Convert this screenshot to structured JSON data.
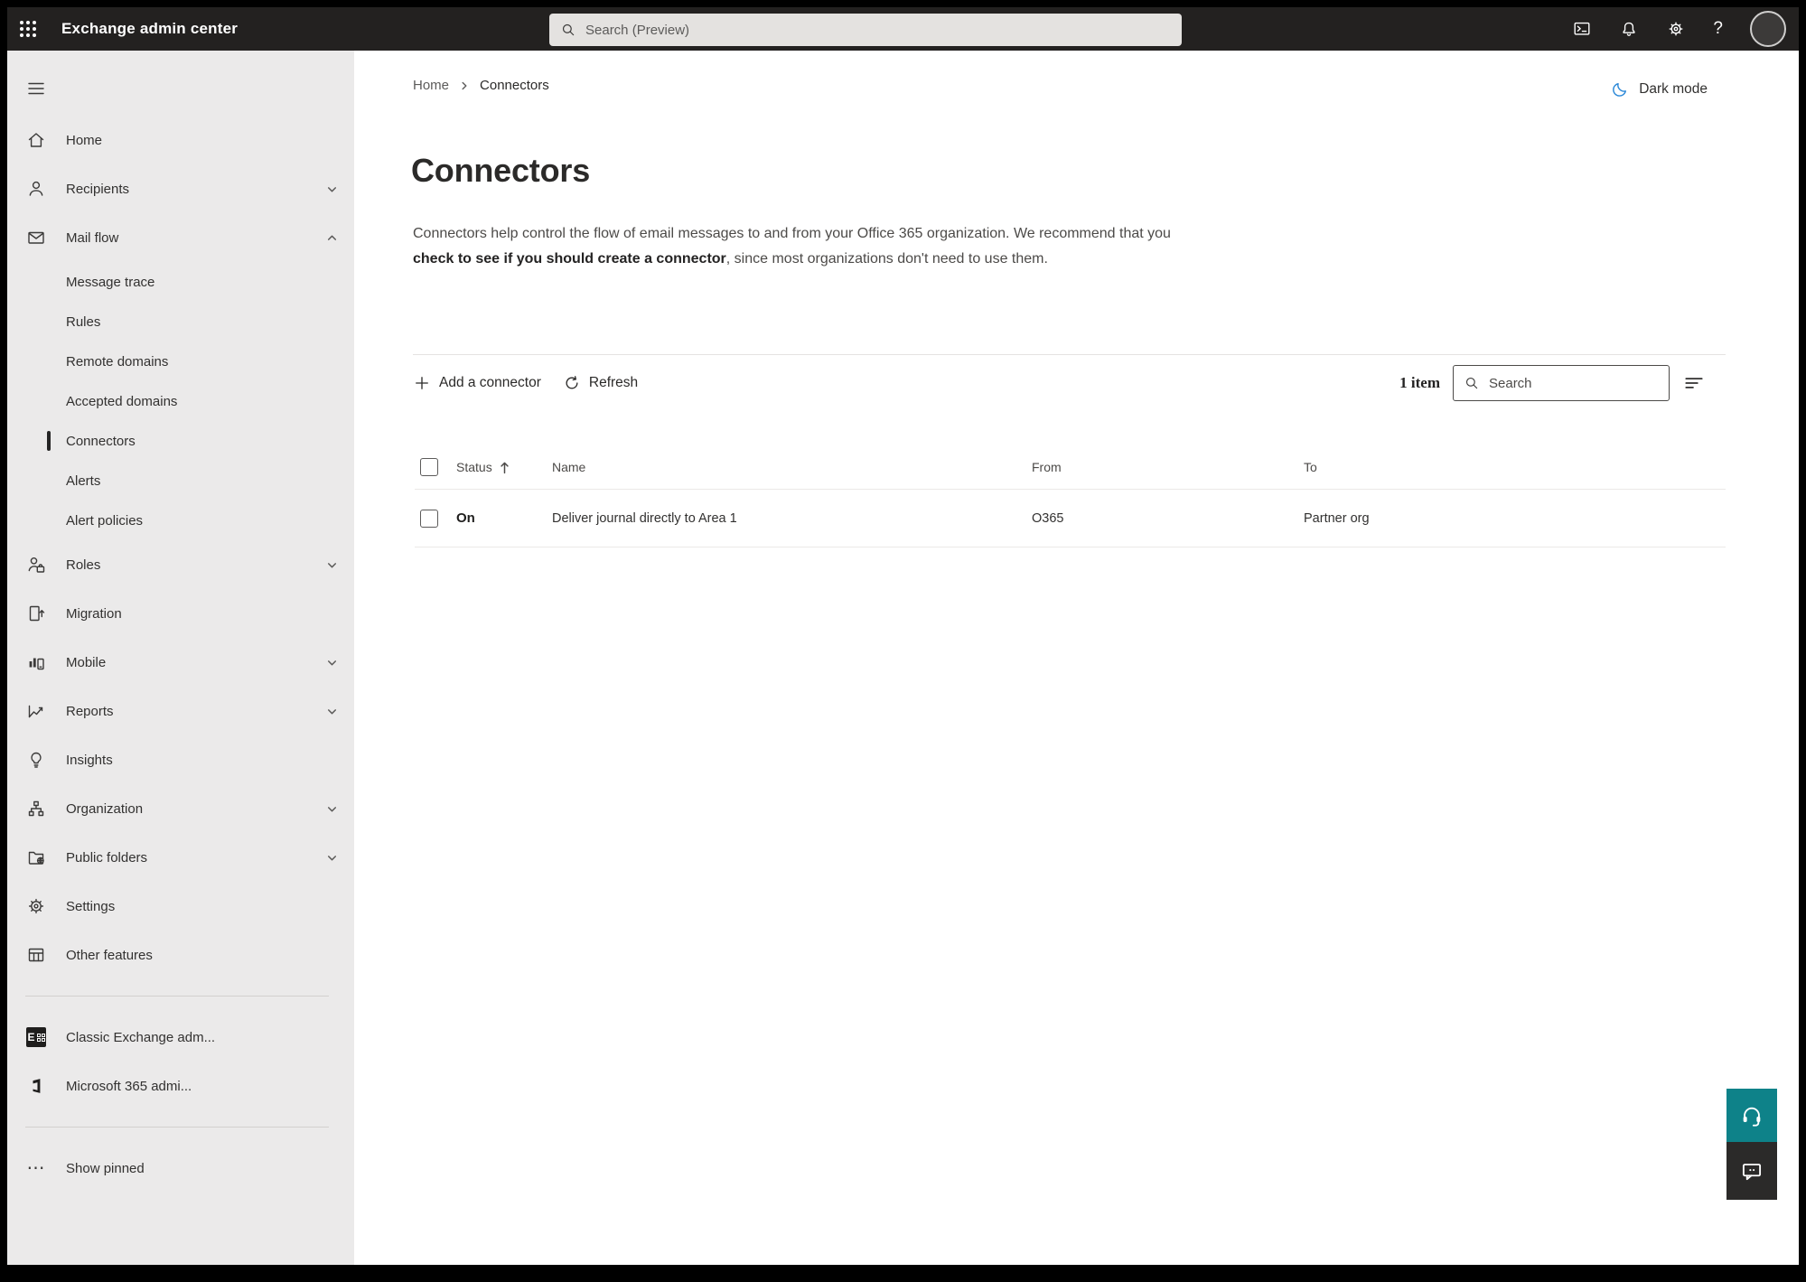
{
  "colors": {
    "teal_accent": "#0e8289",
    "moon_blue": "#2b88d8",
    "topbar_bg": "#232120",
    "sidebar_bg": "#ebeaea",
    "selection_indicator": "#242424"
  },
  "topbar": {
    "title": "Exchange admin center",
    "search_placeholder": "Search (Preview)",
    "help_glyph": "?"
  },
  "sidebar": {
    "show_pinned_glyph": "⋯",
    "items": [
      {
        "label": "Home"
      },
      {
        "label": "Recipients"
      },
      {
        "label": "Mail flow"
      },
      {
        "label": "Message trace"
      },
      {
        "label": "Rules"
      },
      {
        "label": "Remote domains"
      },
      {
        "label": "Accepted domains"
      },
      {
        "label": "Connectors"
      },
      {
        "label": "Alerts"
      },
      {
        "label": "Alert policies"
      },
      {
        "label": "Roles"
      },
      {
        "label": "Migration"
      },
      {
        "label": "Mobile"
      },
      {
        "label": "Reports"
      },
      {
        "label": "Insights"
      },
      {
        "label": "Organization"
      },
      {
        "label": "Public folders"
      },
      {
        "label": "Settings"
      },
      {
        "label": "Other features"
      },
      {
        "label": "Classic Exchange adm..."
      },
      {
        "label": "Microsoft 365 admi..."
      },
      {
        "label": "Show pinned"
      }
    ]
  },
  "breadcrumb": {
    "home": "Home",
    "current": "Connectors"
  },
  "header": {
    "dark_mode_label": "Dark mode",
    "title": "Connectors",
    "description_before": "Connectors help control the flow of email messages to and from your Office 365 organization. We recommend that you ",
    "description_link": "check to see if you should create a connector",
    "description_after": ", since most organizations don't need to use them."
  },
  "toolbar": {
    "add_label": "Add a connector",
    "refresh_label": "Refresh",
    "count_label": "1 item",
    "search_placeholder": "Search"
  },
  "table": {
    "headers": {
      "status": "Status",
      "name": "Name",
      "from": "From",
      "to": "To"
    },
    "rows": [
      {
        "status": "On",
        "name": "Deliver journal directly to Area 1",
        "from": "O365",
        "to": "Partner org"
      }
    ]
  }
}
